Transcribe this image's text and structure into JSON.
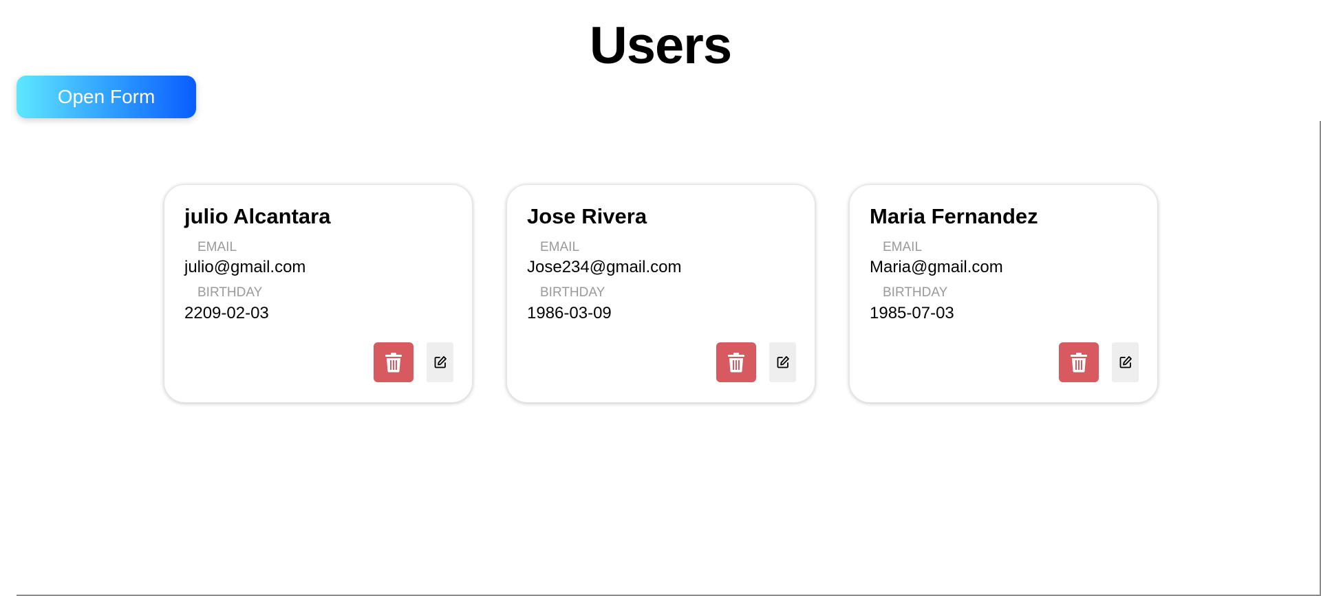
{
  "page": {
    "title": "Users",
    "open_form_label": "Open Form"
  },
  "colors": {
    "delete_button": "#d65a5f",
    "edit_button": "#eeeeee",
    "open_form_gradient_start": "#5ee7ff",
    "open_form_gradient_end": "#0a5cff",
    "label_text": "#9a9a9a"
  },
  "labels": {
    "email": "EMAIL",
    "birthday": "BIRTHDAY"
  },
  "icons": {
    "delete": "trash-icon",
    "edit": "edit-icon"
  },
  "users": [
    {
      "name": "julio Alcantara",
      "email": "julio@gmail.com",
      "birthday": "2209-02-03"
    },
    {
      "name": "Jose Rivera",
      "email": "Jose234@gmail.com",
      "birthday": "1986-03-09"
    },
    {
      "name": "Maria Fernandez",
      "email": "Maria@gmail.com",
      "birthday": "1985-07-03"
    }
  ]
}
